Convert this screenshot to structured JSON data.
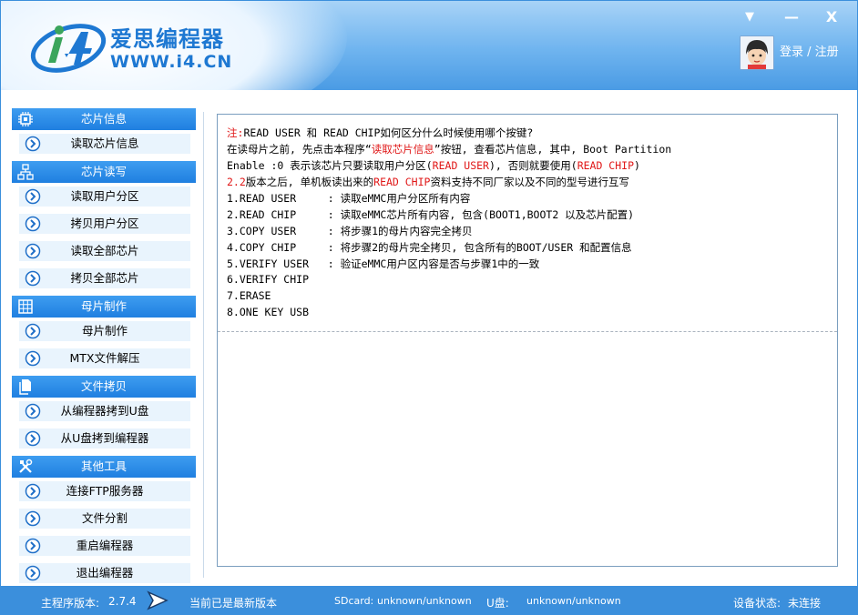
{
  "header": {
    "brand": "爱思编程器",
    "url": "WWW.i4.CN",
    "login": "登录 / 注册",
    "window_buttons": [
      "▼",
      "—",
      "X"
    ]
  },
  "sidebar": {
    "groups": [
      {
        "label": "芯片信息",
        "icon": "chip-icon",
        "items": [
          "读取芯片信息"
        ]
      },
      {
        "label": "芯片读写",
        "icon": "network-icon",
        "items": [
          "读取用户分区",
          "拷贝用户分区",
          "读取全部芯片",
          "拷贝全部芯片"
        ]
      },
      {
        "label": "母片制作",
        "icon": "grid-icon",
        "items": [
          "母片制作",
          "MTX文件解压"
        ]
      },
      {
        "label": "文件拷贝",
        "icon": "files-icon",
        "items": [
          "从编程器拷到U盘",
          "从U盘拷到编程器"
        ]
      },
      {
        "label": "其他工具",
        "icon": "tools-icon",
        "items": [
          "连接FTP服务器",
          "文件分割",
          "重启编程器",
          "退出编程器"
        ]
      }
    ]
  },
  "content": {
    "l1a": "注:",
    "l1b": "READ USER 和 READ CHIP如何区分什么时候使用哪个按键?",
    "l2a": "在读母片之前, 先点击本程序“",
    "l2b": "读取芯片信息",
    "l2c": "”按钮, 查看芯片信息, 其中, Boot Partition",
    "l3a": "Enable :0 表示该芯片只要读取用户分区(",
    "l3b": "READ USER",
    "l3c": "), 否则就要使用(",
    "l3d": "READ CHIP",
    "l3e": ")",
    "l4a": "2.2",
    "l4b": "版本之后, 单机板读出来的",
    "l4c": "READ CHIP",
    "l4d": "资料支持不同厂家以及不同的型号进行互写",
    "steps": [
      "1.READ USER     : 读取eMMC用户分区所有内容",
      "2.READ CHIP     : 读取eMMC芯片所有内容, 包含(BOOT1,BOOT2 以及芯片配置)",
      "3.COPY USER     : 将步骤1的母片内容完全拷贝",
      "4.COPY CHIP     : 将步骤2的母片完全拷贝, 包含所有的BOOT/USER 和配置信息",
      "5.VERIFY USER   : 验证eMMC用户区内容是否与步骤1中的一致",
      "6.VERIFY CHIP",
      "7.ERASE",
      "8.ONE KEY USB"
    ]
  },
  "status": {
    "version_label": "主程序版本:",
    "version": "2.7.4",
    "latest": "当前已是最新版本",
    "sdcard_label": "SDcard:",
    "sdcard": "unknown/unknown",
    "udisk_label": "U盘:",
    "udisk": "unknown/unknown",
    "device_label": "设备状态:",
    "device": "未连接"
  },
  "colors": {
    "accent": "#3b8fdc",
    "highlight": "#e01818",
    "item_bg": "#e9f4fd"
  }
}
